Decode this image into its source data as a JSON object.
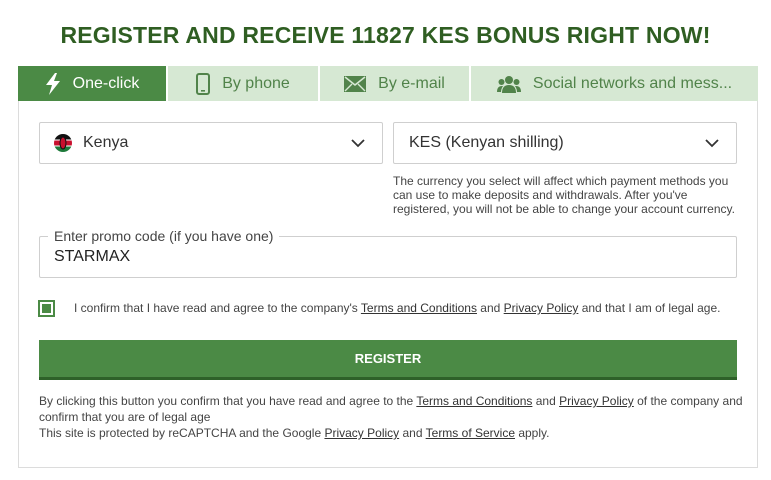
{
  "headline": "REGISTER AND RECEIVE 11827 KES BONUS RIGHT NOW!",
  "tabs": [
    {
      "label": "One-click",
      "icon": "lightning-icon",
      "active": true
    },
    {
      "label": "By phone",
      "icon": "phone-icon",
      "active": false
    },
    {
      "label": "By e-mail",
      "icon": "envelope-icon",
      "active": false
    },
    {
      "label": "Social networks and mess...",
      "icon": "people-icon",
      "active": false
    }
  ],
  "form": {
    "country": {
      "value": "Kenya",
      "flag": "kenya-flag-icon"
    },
    "currency": {
      "value": "KES (Kenyan shilling)"
    },
    "currency_hint": "The currency you select will affect which payment methods you can use to make deposits and withdrawals. After you've registered, you will not be able to change your account currency.",
    "promo": {
      "label": "Enter promo code (if you have one)",
      "value": "STARMAX"
    },
    "agree": {
      "checked": true,
      "text_before": "I confirm that I have read and agree to the company's ",
      "terms_link": "Terms and Conditions",
      "text_and": " and ",
      "privacy_link": "Privacy Policy",
      "text_after": " and that I am of legal age."
    },
    "register_label": "REGISTER"
  },
  "footnote": {
    "line1_before": "By clicking this button you confirm that you have read and agree to the ",
    "terms_link": "Terms and Conditions",
    "and": " and ",
    "privacy_link": "Privacy Policy",
    "line1_after": " of the company and confirm that you are of legal age",
    "line2_before": "This site is protected by reCAPTCHA and the Google ",
    "privacy_link2": "Privacy Policy",
    "and2": " and ",
    "tos_link": "Terms of Service",
    "line2_after": " apply."
  },
  "colors": {
    "brand_green": "#4b8a45",
    "headline_green": "#2f5e22",
    "tab_inactive_bg": "#d6e8d3"
  }
}
